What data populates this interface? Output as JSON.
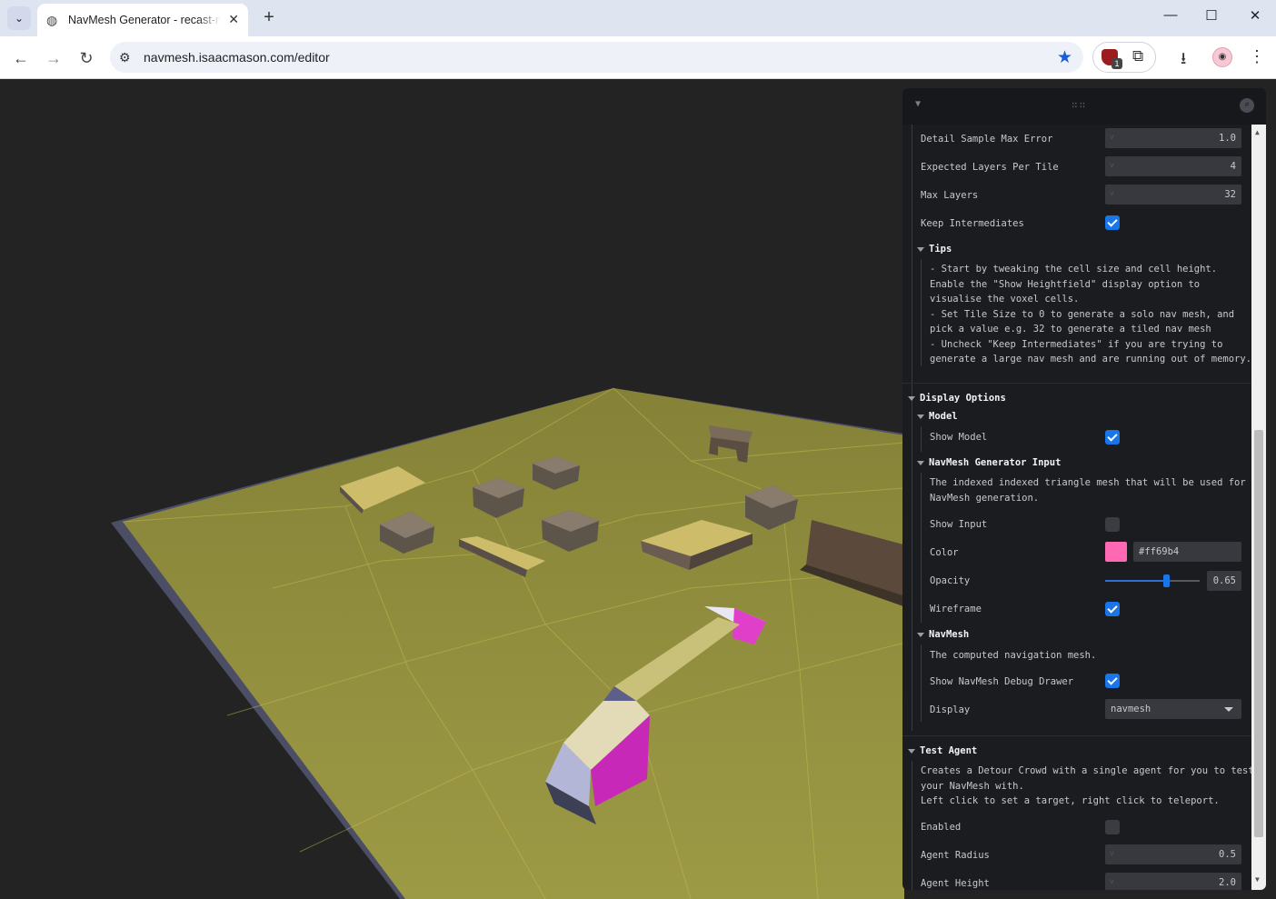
{
  "browser": {
    "tab_title": "NavMesh Generator - recast-navigation",
    "url": "navmesh.isaacmason.com/editor",
    "extension_badge": "1",
    "icons": {
      "tab_list": "chevron-down-icon",
      "globe": "globe-icon",
      "tab_close": "close-icon",
      "new_tab": "plus-icon",
      "back": "arrow-left-icon",
      "forward": "arrow-right-icon",
      "reload": "reload-icon",
      "site_controls": "tune-icon",
      "bookmark": "star-icon",
      "extensions": "puzzle-icon",
      "download": "download-icon",
      "menu": "kebab-menu-icon"
    },
    "accent": "#1a5fd6"
  },
  "panel": {
    "rows_top": [
      {
        "label": "Detail Sample Max Error",
        "value": "1.0"
      },
      {
        "label": "Expected Layers Per Tile",
        "value": "4"
      },
      {
        "label": "Max Layers",
        "value": "32"
      }
    ],
    "keep_intermediates": {
      "label": "Keep Intermediates",
      "checked": true
    },
    "tips": {
      "title": "Tips",
      "lines": [
        "- Start by tweaking the cell size and cell height.",
        "Enable the \"Show Heightfield\" display option to",
        "visualise the voxel cells.",
        "- Set Tile Size to 0 to generate a solo nav mesh, and",
        "pick a value e.g. 32 to generate a tiled nav mesh",
        "- Uncheck \"Keep Intermediates\" if you are trying to",
        "generate a large nav mesh and are running out of memory."
      ]
    },
    "display_options": {
      "title": "Display Options",
      "model": {
        "title": "Model",
        "show_model_label": "Show Model",
        "show_model": true
      },
      "input": {
        "title": "NavMesh Generator Input",
        "desc_lines": [
          "The indexed indexed triangle mesh that will be used for",
          "NavMesh generation."
        ],
        "show_input_label": "Show Input",
        "show_input": false,
        "color_label": "Color",
        "color_value": "#ff69b4",
        "opacity_label": "Opacity",
        "opacity_value": "0.65",
        "opacity_fraction": 0.65,
        "wireframe_label": "Wireframe",
        "wireframe": true
      },
      "navmesh": {
        "title": "NavMesh",
        "desc": "The computed navigation mesh.",
        "debug_label": "Show NavMesh Debug Drawer",
        "debug": true,
        "display_label": "Display",
        "display_value": "navmesh"
      }
    },
    "test_agent": {
      "title": "Test Agent",
      "desc_lines": [
        "Creates a Detour Crowd with a single agent for you to test",
        "your NavMesh with.",
        "Left click to set a target, right click to teleport."
      ],
      "enabled_label": "Enabled",
      "enabled": false,
      "rows": [
        {
          "label": "Agent Radius",
          "value": "0.5"
        },
        {
          "label": "Agent Height",
          "value": "2.0"
        }
      ]
    },
    "checkbox_color": "#1a75e8"
  }
}
